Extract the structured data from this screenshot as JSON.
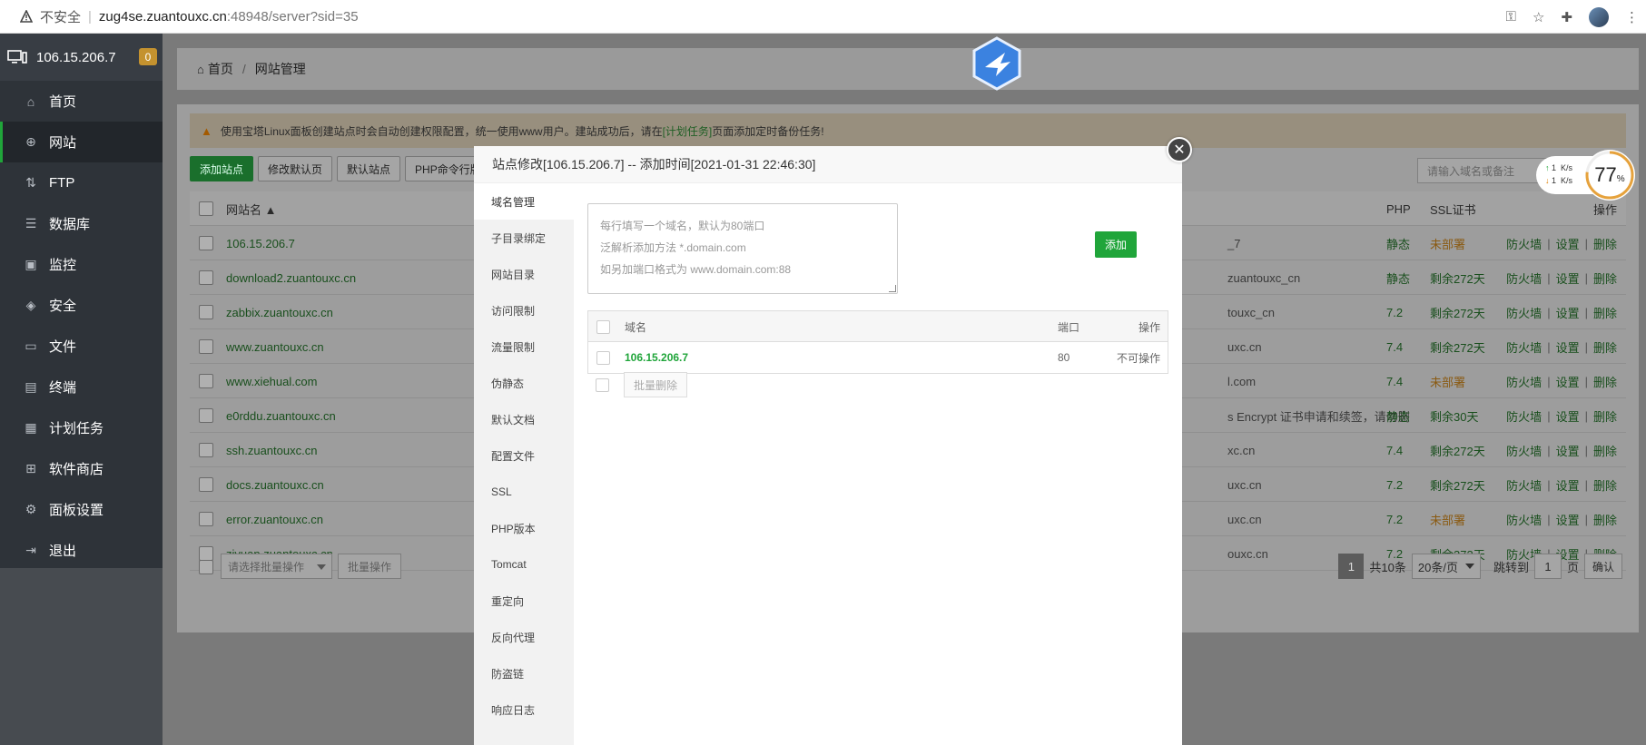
{
  "browser": {
    "insecure_label": "不安全",
    "url_host": "zug4se.zuantouxc.cn",
    "url_path": ":48948/server?sid=35"
  },
  "sidebar": {
    "server_ip": "106.15.206.7",
    "badge": "0",
    "items": [
      {
        "label": "首页",
        "icon": "home-icon"
      },
      {
        "label": "网站",
        "icon": "globe-icon"
      },
      {
        "label": "FTP",
        "icon": "ftp-icon"
      },
      {
        "label": "数据库",
        "icon": "database-icon"
      },
      {
        "label": "监控",
        "icon": "monitor-icon"
      },
      {
        "label": "安全",
        "icon": "shield-icon"
      },
      {
        "label": "文件",
        "icon": "folder-icon"
      },
      {
        "label": "终端",
        "icon": "terminal-icon"
      },
      {
        "label": "计划任务",
        "icon": "calendar-icon"
      },
      {
        "label": "软件商店",
        "icon": "apps-icon"
      },
      {
        "label": "面板设置",
        "icon": "gear-icon"
      },
      {
        "label": "退出",
        "icon": "logout-icon"
      }
    ]
  },
  "breadcrumb": {
    "home": "首页",
    "current": "网站管理"
  },
  "notice": {
    "text_before": "使用宝塔Linux面板创建站点时会自动创建权限配置，统一使用www用户。建站成功后，请在",
    "link": "[计划任务]",
    "text_after": "页面添加定时备份任务!"
  },
  "toolbar": {
    "add_site": "添加站点",
    "edit_default": "修改默认页",
    "default_site": "默认站点",
    "php_cmd": "PHP命令行版"
  },
  "search": {
    "placeholder": "请输入域名或备注"
  },
  "table": {
    "headers": {
      "name": "网站名 ▲",
      "php": "PHP",
      "ssl": "SSL证书",
      "ops": "操作"
    },
    "rows": [
      {
        "name": "106.15.206.7",
        "right": "_7",
        "php": "静态",
        "ssl": "未部署",
        "ssl_ok": false
      },
      {
        "name": "download2.zuantouxc.cn",
        "right": "zuantouxc_cn",
        "php": "静态",
        "ssl": "剩余272天",
        "ssl_ok": true
      },
      {
        "name": "zabbix.zuantouxc.cn",
        "right": "touxc_cn",
        "php": "7.2",
        "ssl": "剩余272天",
        "ssl_ok": true
      },
      {
        "name": "www.zuantouxc.cn",
        "right": "uxc.cn",
        "php": "7.4",
        "ssl": "剩余272天",
        "ssl_ok": true
      },
      {
        "name": "www.xiehual.com",
        "right": "l.com",
        "php": "7.4",
        "ssl": "未部署",
        "ssl_ok": false
      },
      {
        "name": "e0rddu.zuantouxc.cn",
        "right": "s Encrypt 证书申请和续签，请勿删",
        "php": "静态",
        "ssl": "剩余30天",
        "ssl_ok": true
      },
      {
        "name": "ssh.zuantouxc.cn",
        "right": "xc.cn",
        "php": "7.4",
        "ssl": "剩余272天",
        "ssl_ok": true
      },
      {
        "name": "docs.zuantouxc.cn",
        "right": "uxc.cn",
        "php": "7.2",
        "ssl": "剩余272天",
        "ssl_ok": true
      },
      {
        "name": "error.zuantouxc.cn",
        "right": "uxc.cn",
        "php": "7.2",
        "ssl": "未部署",
        "ssl_ok": false
      },
      {
        "name": "ziyuan.zuantouxc.cn",
        "right": "ouxc.cn",
        "php": "7.2",
        "ssl": "剩余272天",
        "ssl_ok": true
      }
    ],
    "ops": {
      "firewall": "防火墙",
      "settings": "设置",
      "delete": "删除",
      "sep": "|"
    }
  },
  "footer": {
    "batch_select": "请选择批量操作",
    "batch_btn": "批量操作",
    "page": "1",
    "total": "共10条",
    "per_page": "20条/页",
    "jump_label": "跳转到",
    "jump_value": "1",
    "page_unit": "页",
    "confirm": "确认"
  },
  "speed": {
    "up": "1",
    "down": "1",
    "unit": "K/s",
    "load_value": "77",
    "load_unit": "%",
    "load_fraction": 0.77
  },
  "modal": {
    "title": "站点修改[106.15.206.7] -- 添加时间[2021-01-31 22:46:30]",
    "tabs": [
      "域名管理",
      "子目录绑定",
      "网站目录",
      "访问限制",
      "流量限制",
      "伪静态",
      "默认文档",
      "配置文件",
      "SSL",
      "PHP版本",
      "Tomcat",
      "重定向",
      "反向代理",
      "防盗链",
      "响应日志"
    ],
    "placeholder_lines": [
      "每行填写一个域名，默认为80端口",
      "泛解析添加方法 *.domain.com",
      "如另加端口格式为 www.domain.com:88"
    ],
    "add_button": "添加",
    "table_headers": {
      "domain": "域名",
      "port": "端口",
      "ops": "操作"
    },
    "domains": [
      {
        "domain": "106.15.206.7",
        "port": "80",
        "ops": "不可操作"
      }
    ],
    "batch_delete": "批量删除"
  }
}
